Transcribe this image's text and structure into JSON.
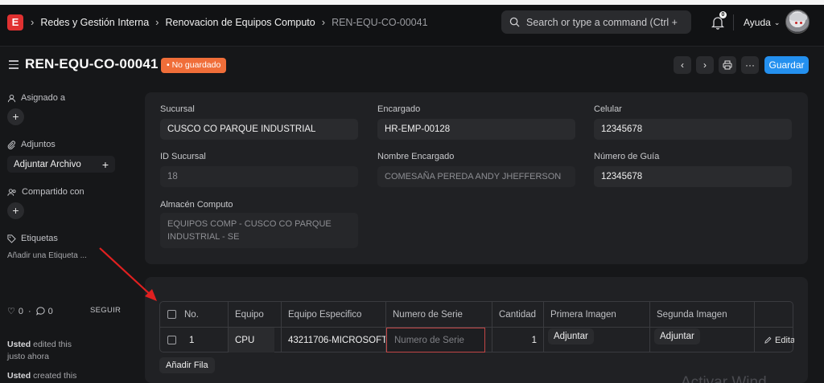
{
  "nav": {
    "breadcrumbs": [
      "Redes y Gestión Interna",
      "Renovacion de Equipos Computo",
      "REN-EQU-CO-00041"
    ],
    "search_placeholder": "Search or type a command (Ctrl + G)",
    "notification_count": "0",
    "help_label": "Ayuda"
  },
  "header": {
    "title": "REN-EQU-CO-00041",
    "status": "• No guardado",
    "save_label": "Guardar"
  },
  "sidebar": {
    "assigned_label": "Asignado a",
    "attachments_label": "Adjuntos",
    "attach_file_label": "Adjuntar Archivo",
    "shared_label": "Compartido con",
    "tags_label": "Etiquetas",
    "add_tag_label": "Añadir una Etiqueta ...",
    "likes": "0",
    "comments": "0",
    "follow_label": "SEGUIR",
    "activity": [
      {
        "user": "Usted",
        "text": " edited this justo ahora"
      },
      {
        "user": "Usted",
        "text": " created this"
      }
    ]
  },
  "form": {
    "sucursal": {
      "label": "Sucursal",
      "value": "CUSCO CO PARQUE INDUSTRIAL"
    },
    "encargado": {
      "label": "Encargado",
      "value": "HR-EMP-00128"
    },
    "celular": {
      "label": "Celular",
      "value": "12345678"
    },
    "id_sucursal": {
      "label": "ID Sucursal",
      "value": "18"
    },
    "nombre_encargado": {
      "label": "Nombre Encargado",
      "value": "COMESAÑA PEREDA ANDY JHEFFERSON"
    },
    "numero_guia": {
      "label": "Número de Guía",
      "value": "12345678"
    },
    "almacen": {
      "label": "Almacén Computo",
      "value_line1": "EQUIPOS COMP - CUSCO CO PARQUE",
      "value_line2": "INDUSTRIAL - SE"
    }
  },
  "table": {
    "headers": [
      "No.",
      "Equipo",
      "Equipo Especifico",
      "Numero de Serie",
      "Cantidad",
      "Primera Imagen",
      "Segunda Imagen"
    ],
    "row": {
      "no": "1",
      "equipo": "CPU",
      "especifico": "43211706-MICROSOFT",
      "serie_placeholder": "Numero de Serie",
      "cantidad": "1",
      "primera": "Adjuntar",
      "segunda": "Adjuntar",
      "edit": "Editar"
    },
    "add_row_label": "Añadir Fila"
  },
  "watermark": "Activar Wind"
}
